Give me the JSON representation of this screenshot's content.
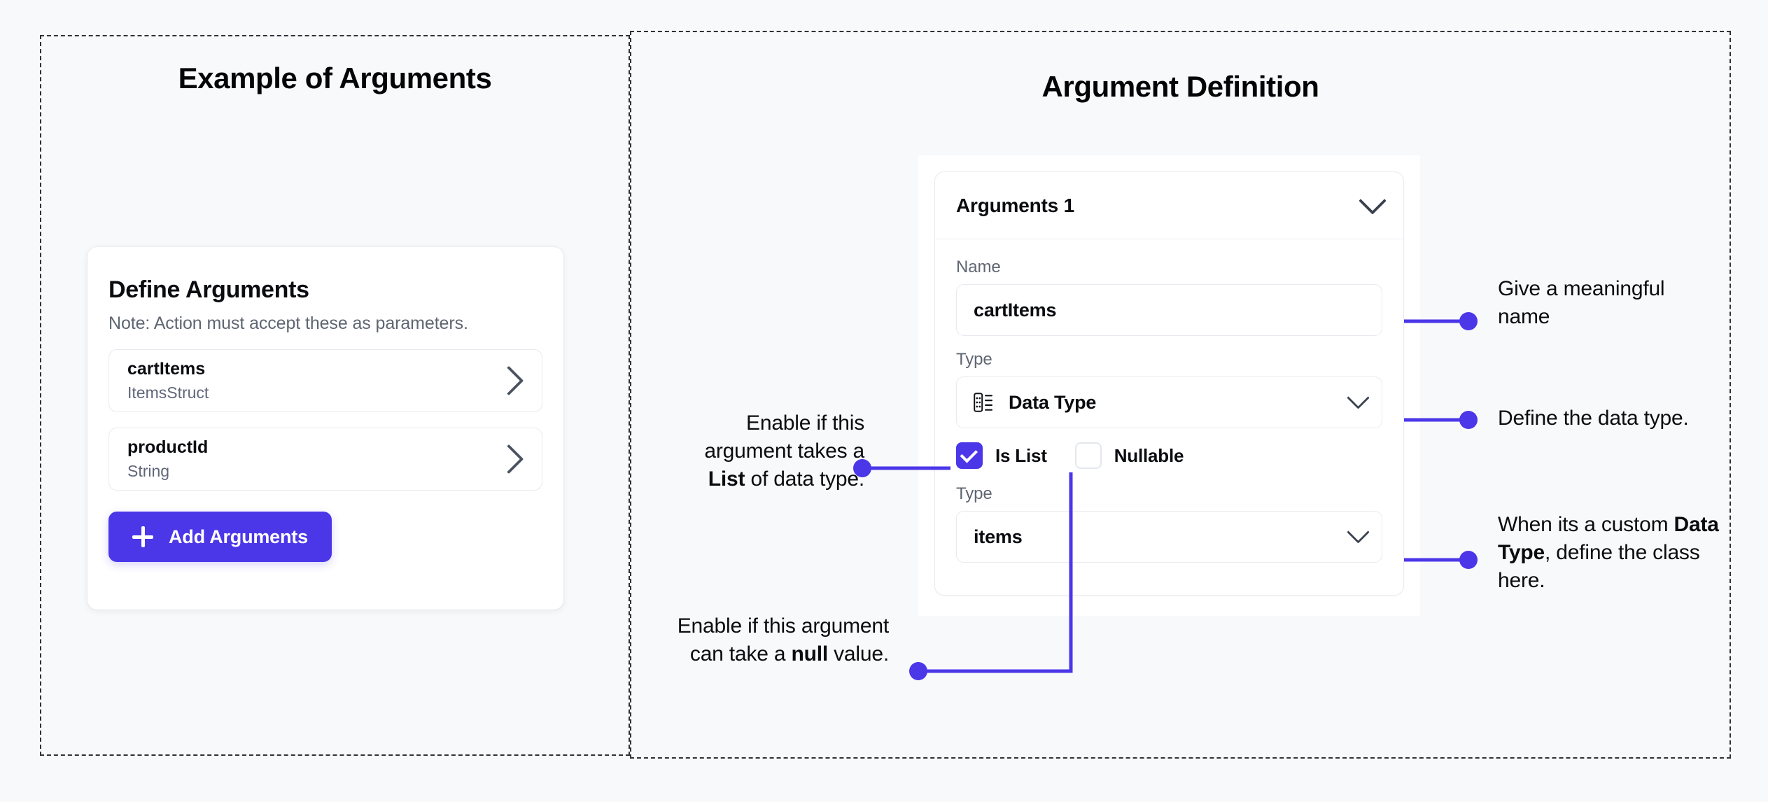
{
  "panels": {
    "left_title": "Example of Arguments",
    "right_title": "Argument Definition"
  },
  "example_card": {
    "heading": "Define Arguments",
    "note": "Note: Action must accept these as parameters.",
    "arguments": [
      {
        "name": "cartItems",
        "type": "ItemsStruct"
      },
      {
        "name": "productId",
        "type": "String"
      }
    ],
    "add_button_label": "Add Arguments"
  },
  "definition_form": {
    "header_label": "Arguments 1",
    "name_label": "Name",
    "name_value": "cartItems",
    "type_label": "Type",
    "type_value": "Data Type",
    "type_icon": "data-type-icon",
    "is_list_label": "Is List",
    "is_list_checked": true,
    "nullable_label": "Nullable",
    "nullable_checked": false,
    "subtype_label": "Type",
    "subtype_value": "items"
  },
  "annotations": {
    "name": {
      "text": "Give a meaningful name"
    },
    "data_type": {
      "text": "Define the data type."
    },
    "custom_type": {
      "prefix": "When its a custom ",
      "bold": "Data Type",
      "suffix": ", define the class here."
    },
    "is_list": {
      "prefix": "Enable if this argument takes a ",
      "bold": "List",
      "suffix": " of data type."
    },
    "nullable": {
      "prefix": "Enable if this argument can take a ",
      "bold": "null",
      "suffix": " value."
    }
  },
  "colors": {
    "accent": "#4b36e8",
    "background": "#f7f9fb",
    "card": "#ffffff",
    "text": "#0b0c10",
    "muted": "#5f6672",
    "border": "#e8eaef"
  }
}
